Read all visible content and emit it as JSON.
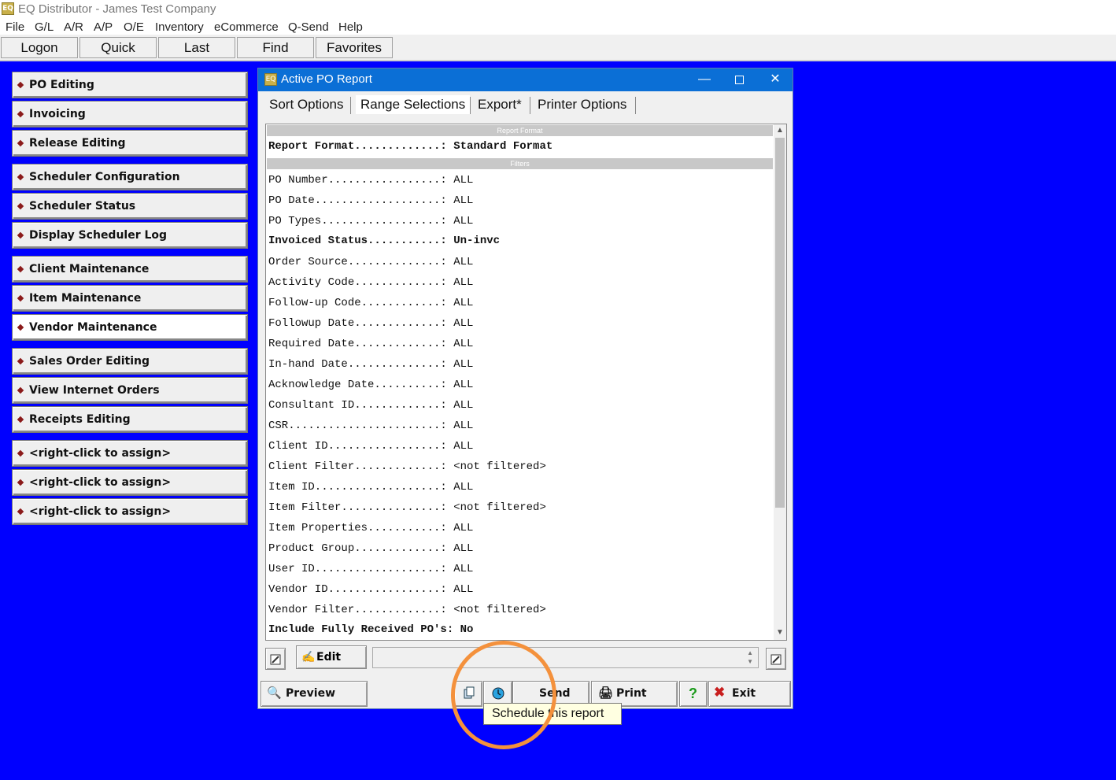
{
  "app": {
    "title": "EQ Distributor - James Test Company",
    "icon_text": "EQ"
  },
  "menu": [
    "File",
    "G/L",
    "A/R",
    "A/P",
    "O/E",
    "Inventory",
    "eCommerce",
    "Q-Send",
    "Help"
  ],
  "toolbar": [
    "Logon",
    "Quick",
    "Last",
    "Find",
    "Favorites"
  ],
  "nav": [
    "PO Editing",
    "Invoicing",
    "Release Editing",
    "Scheduler Configuration",
    "Scheduler Status",
    "Display Scheduler Log",
    "Client Maintenance",
    "Item Maintenance",
    "Vendor Maintenance",
    "Sales Order Editing",
    "View Internet Orders",
    "Receipts Editing",
    "<right-click to assign>",
    "<right-click to assign>",
    "<right-click to assign>"
  ],
  "window": {
    "title": "Active PO Report",
    "tabs": [
      "Sort Options",
      "Range Selections",
      "Export*",
      "Printer Options"
    ],
    "section_report_format": "Report Format",
    "section_filters": "Filters",
    "report_format_row": "Report Format.............: Standard Format",
    "rows": [
      "PO Number.................: ALL",
      "PO Date...................: ALL",
      "PO Types..................: ALL",
      "Invoiced Status...........: Un-invc",
      "Order Source..............: ALL",
      "Activity Code.............: ALL",
      "Follow-up Code............: ALL",
      "Followup Date.............: ALL",
      "Required Date.............: ALL",
      "In-hand Date..............: ALL",
      "Acknowledge Date..........: ALL",
      "Consultant ID.............: ALL",
      "CSR.......................: ALL",
      "Client ID.................: ALL",
      "Client Filter.............: <not filtered>",
      "Item ID...................: ALL",
      "Item Filter...............: <not filtered>",
      "Item Properties...........: ALL",
      "Product Group.............: ALL",
      "User ID...................: ALL",
      "Vendor ID.................: ALL",
      "Vendor Filter.............: <not filtered>",
      "Include Fully Received PO's: No"
    ],
    "edit_label": "Edit",
    "buttons": {
      "preview": "Preview",
      "send": "Send",
      "print": "Print",
      "help": "?",
      "exit": "Exit"
    }
  },
  "tooltip": "Schedule this report",
  "colors": {
    "desktop": "#0000ff",
    "titlebar": "#0b6fd6",
    "highlight_circle": "#f4913c"
  }
}
